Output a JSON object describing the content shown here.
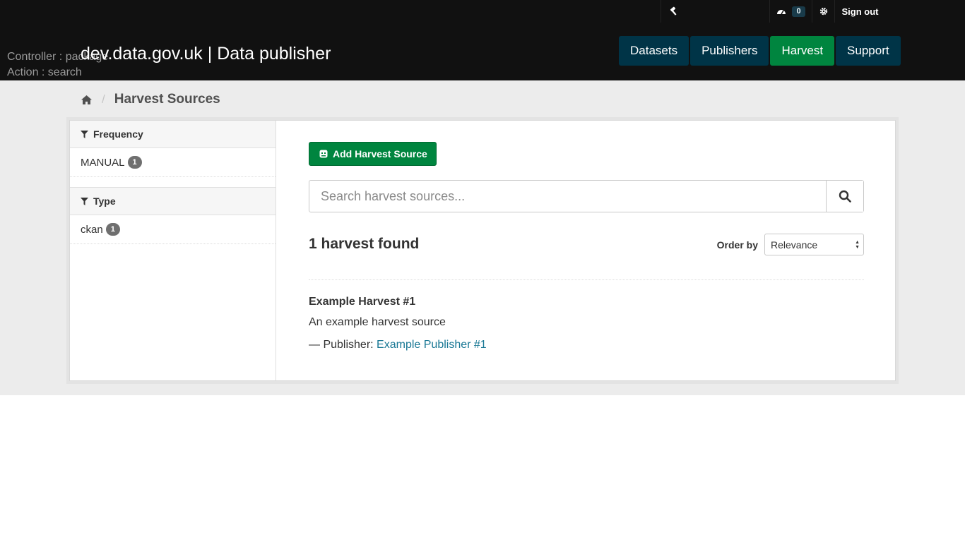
{
  "header": {
    "debug_controller": "Controller : package",
    "debug_action": "Action : search",
    "site_title": "dev.data.gov.uk | Data publisher",
    "dashboard_count": "0",
    "sign_out": "Sign out",
    "nav": [
      {
        "label": "Datasets",
        "active": false
      },
      {
        "label": "Publishers",
        "active": false
      },
      {
        "label": "Harvest",
        "active": true
      },
      {
        "label": "Support",
        "active": false
      }
    ]
  },
  "breadcrumb": {
    "home_icon": "home-icon",
    "current": "Harvest Sources"
  },
  "facets": [
    {
      "title": "Frequency",
      "items": [
        {
          "label": "MANUAL",
          "count": "1"
        }
      ]
    },
    {
      "title": "Type",
      "items": [
        {
          "label": "ckan",
          "count": "1"
        }
      ]
    }
  ],
  "main": {
    "add_button": "Add Harvest Source",
    "search_placeholder": "Search harvest sources...",
    "results_count": "1 harvest found",
    "order_by_label": "Order by",
    "order_by_value": "Relevance",
    "results": [
      {
        "title": "Example Harvest #1",
        "description": "An example harvest source",
        "publisher_prefix": "— Publisher: ",
        "publisher": "Example Publisher #1"
      }
    ]
  },
  "colors": {
    "header_bg": "#111111",
    "nav_bg": "#003447",
    "nav_active": "#00853f",
    "link": "#187794"
  }
}
